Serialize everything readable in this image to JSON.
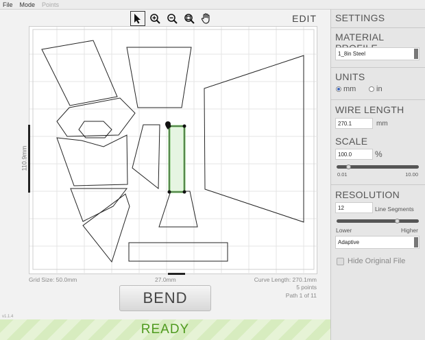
{
  "menu": {
    "items": [
      "File",
      "Mode",
      "Points"
    ]
  },
  "toolbar": {
    "tools": [
      "select-arrow-icon",
      "zoom-in-icon",
      "zoom-out-icon",
      "zoom-fit-icon",
      "pan-hand-icon"
    ],
    "mode_label": "EDIT"
  },
  "canvas": {
    "grid_size": "Grid Size: 50.0mm",
    "vertical_dimension": "110.9mm",
    "horizontal_dimension": "27.0mm",
    "curve_length": "Curve Length: 270.1mm",
    "points_count": "5 points",
    "path_index": "Path 1 of 11"
  },
  "bend_button": "BEND",
  "version": "v1.1.4",
  "status": "READY",
  "sidebar": {
    "title": "SETTINGS",
    "material_profile": {
      "title": "MATERIAL PROFILE",
      "selected": "1_8in Steel"
    },
    "units": {
      "title": "UNITS",
      "options": [
        "mm",
        "in"
      ],
      "selected": "mm"
    },
    "wire_length": {
      "title": "WIRE LENGTH",
      "value": "270.1",
      "unit": "mm"
    },
    "scale": {
      "title": "SCALE",
      "value": "100.0",
      "unit": "%",
      "min_label": "0.01",
      "max_label": "10.00",
      "level": 0.12
    },
    "resolution": {
      "title": "RESOLUTION",
      "value": "12",
      "unit": "Line Segments",
      "low_label": "Lower",
      "high_label": "Higher",
      "level": 0.75,
      "mode": "Adaptive"
    },
    "hide_original_label": "Hide Original File"
  }
}
